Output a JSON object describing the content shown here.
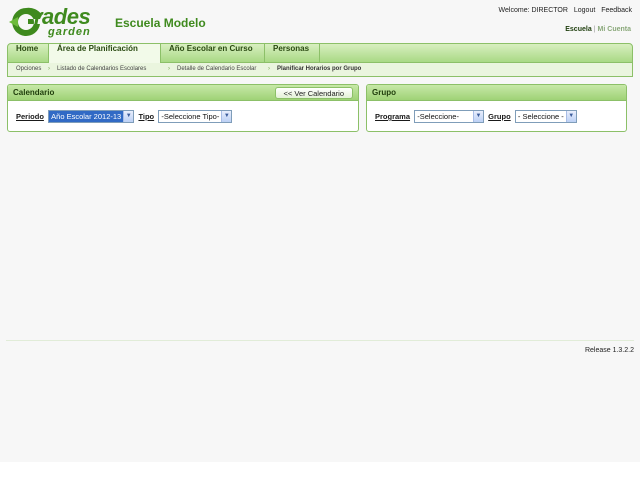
{
  "brand": {
    "logo_word1": "rades",
    "logo_word2": "garden",
    "school_name": "Escuela Modelo",
    "accent": "#3f8a1e"
  },
  "user_bar": {
    "welcome": "Welcome: DIRECTOR",
    "logout": "Logout",
    "feedback": "Feedback"
  },
  "account_bar": {
    "school": "Escuela",
    "my_account": "Mi Cuenta"
  },
  "nav": {
    "tabs": [
      {
        "label": "Home"
      },
      {
        "label": "Área de Planificación"
      },
      {
        "label": "Año Escolar en Curso"
      },
      {
        "label": "Personas"
      }
    ]
  },
  "breadcrumb": [
    "Opciones",
    "Listado de Calendarios Escolares",
    "Detalle de Calendario Escolar",
    "Planificar Horarios por Grupo"
  ],
  "calendar_panel": {
    "title": "Calendario",
    "back_button": "<< Ver Calendario",
    "periodo_label": "Periodo",
    "periodo_value": "Año Escolar 2012-13",
    "tipo_label": "Tipo",
    "tipo_value": "-Seleccione Tipo-"
  },
  "group_panel": {
    "title": "Grupo",
    "programa_label": "Programa",
    "programa_value": "-Seleccione-",
    "grupo_label": "Grupo",
    "grupo_value": "- Seleccione -"
  },
  "footer": {
    "release": "Release 1.3.2.2"
  }
}
